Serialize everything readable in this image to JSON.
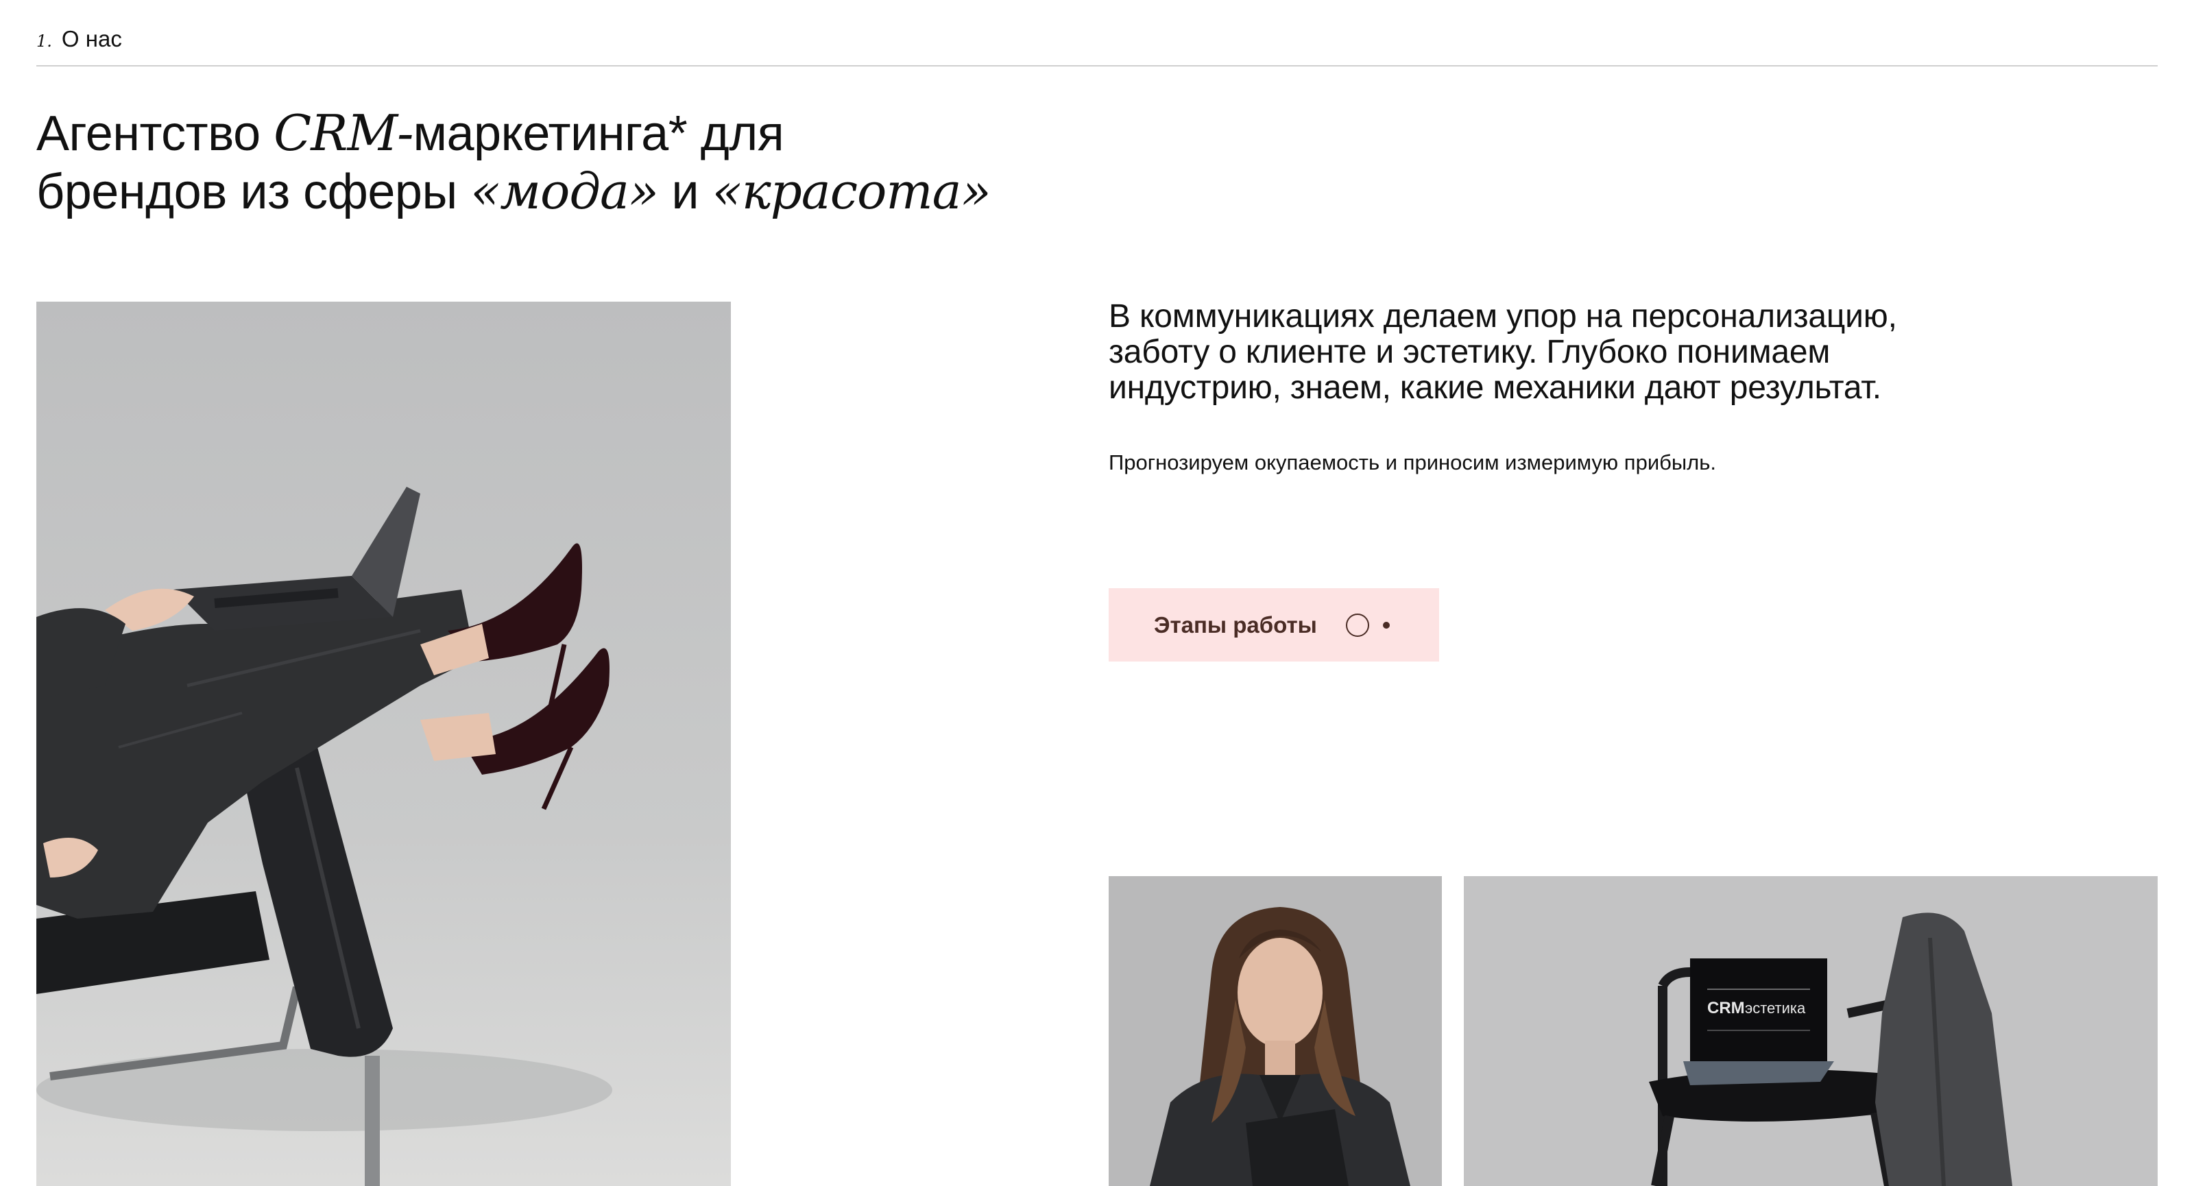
{
  "section": {
    "number": "1.",
    "title": "О нас"
  },
  "headline": {
    "line1": {
      "a": "Агентство ",
      "b": "CRM-",
      "c": "маркетинга* для"
    },
    "line2": {
      "a": "брендов из сферы ",
      "b": "«мода»",
      "c": " и ",
      "d": "«красота»"
    }
  },
  "lead": {
    "line1": "В коммуникациях делаем упор на персонализацию,",
    "line2": "заботу о клиенте и эстетику. Глубоко понимаем",
    "line3": "индустрию, знаем, какие механики дают результат."
  },
  "sub": "Прогнозируем окупаемость и приносим измеримую прибыль.",
  "cta": {
    "label": "Этапы работы",
    "bg": "#fde3e3",
    "fg": "#4a2c25"
  },
  "images": {
    "main": {
      "icon": "photo-woman-in-chair-with-laptop"
    },
    "portrait": {
      "icon": "photo-woman-portrait"
    },
    "chair": {
      "icon": "photo-chair-with-laptop",
      "screen_logo_bold": "CRM",
      "screen_logo_light": "эстетика"
    }
  }
}
